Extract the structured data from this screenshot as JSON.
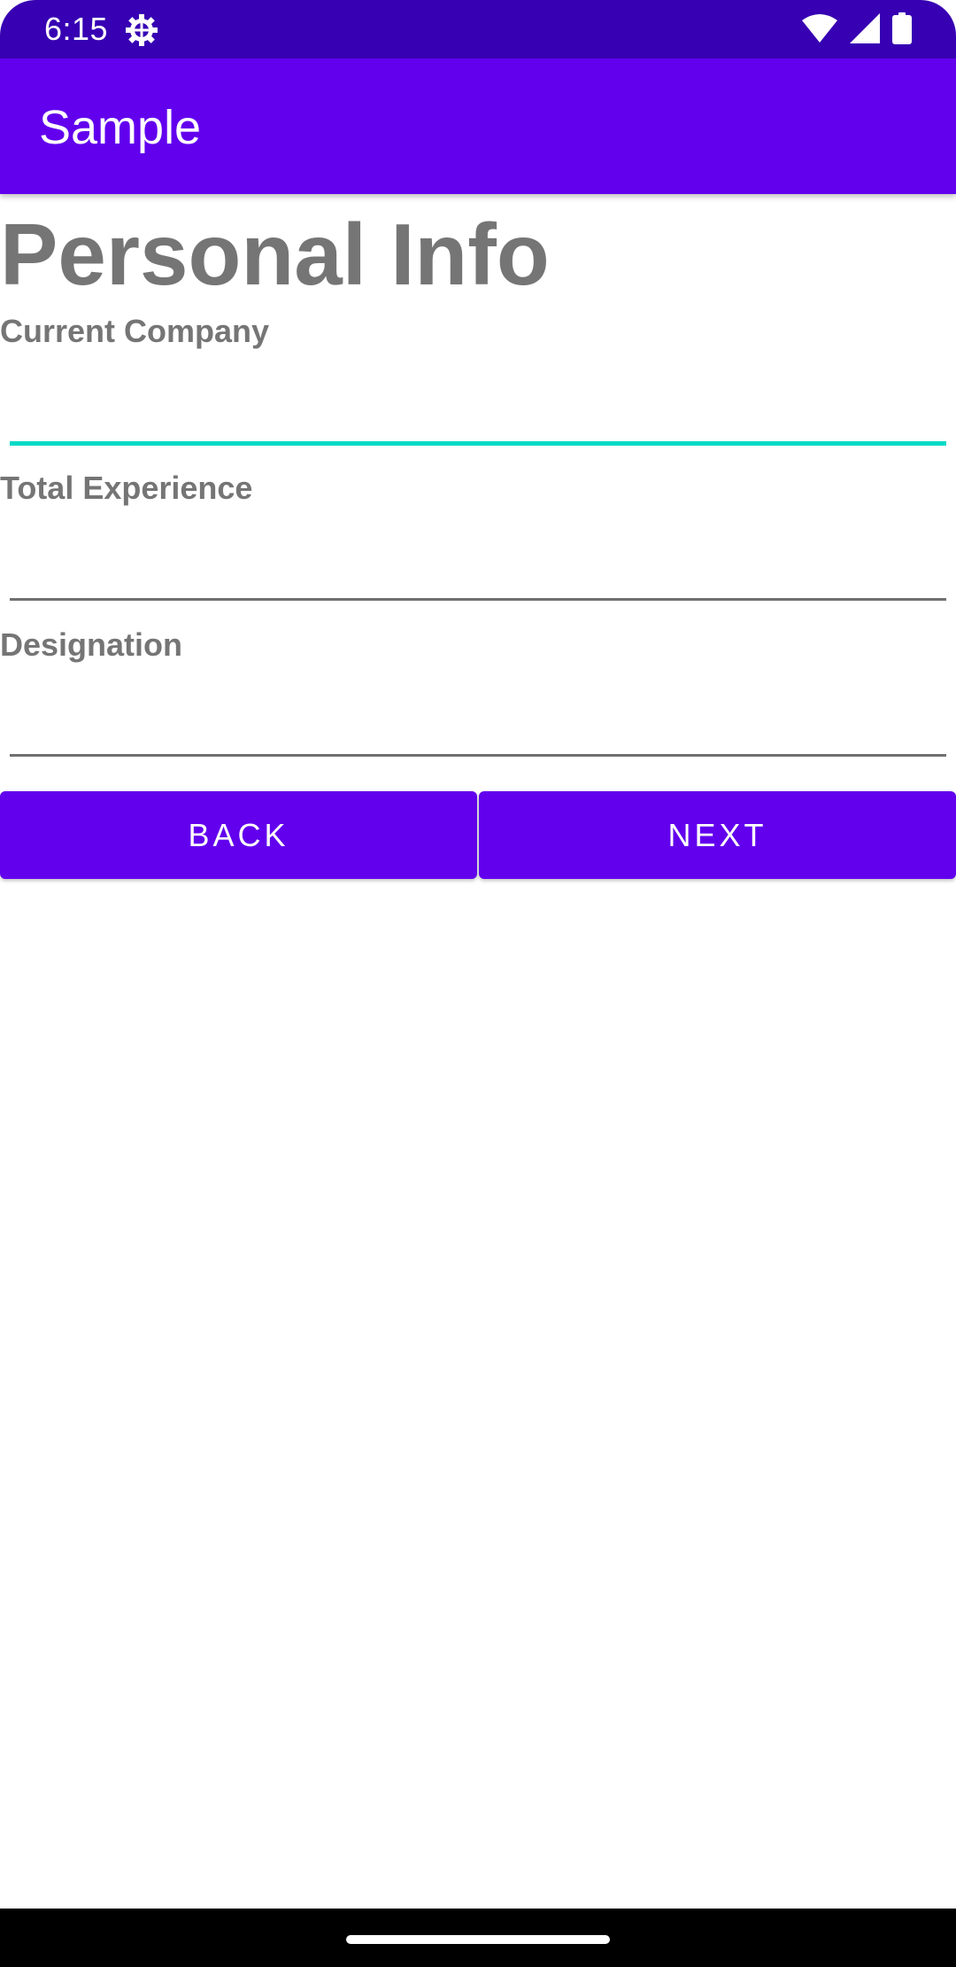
{
  "status_bar": {
    "time": "6:15",
    "icons": [
      "settings-gear-icon",
      "wifi-icon",
      "cellular-signal-icon",
      "battery-icon"
    ]
  },
  "app_bar": {
    "title": "Sample"
  },
  "form": {
    "heading": "Personal Info",
    "fields": [
      {
        "label": "Current Company",
        "value": "",
        "focused": true
      },
      {
        "label": "Total Experience",
        "value": "",
        "focused": false
      },
      {
        "label": "Designation",
        "value": "",
        "focused": false
      }
    ]
  },
  "buttons": {
    "back_label": "BACK",
    "next_label": "NEXT"
  },
  "colors": {
    "status_bar": "#3700B3",
    "primary": "#6200EE",
    "focus_accent": "#03DAC5",
    "label_text": "#757575"
  }
}
